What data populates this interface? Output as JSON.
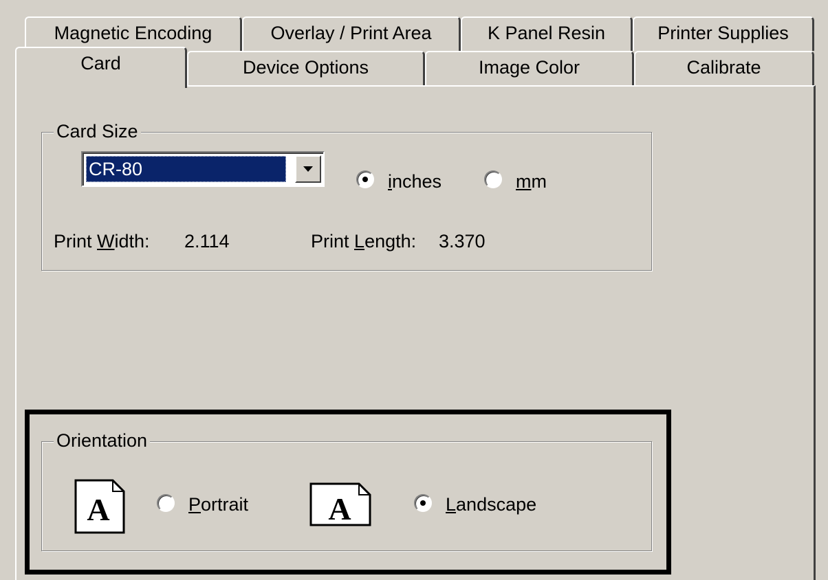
{
  "tabs_row1": [
    {
      "label": "Magnetic Encoding"
    },
    {
      "label": "Overlay / Print Area"
    },
    {
      "label": "K Panel Resin"
    },
    {
      "label": "Printer Supplies"
    }
  ],
  "tabs_row2": [
    {
      "label": "Card",
      "active": true
    },
    {
      "label": "Device Options"
    },
    {
      "label": "Image Color"
    },
    {
      "label": "Calibrate"
    }
  ],
  "card_size": {
    "group_label": "Card Size",
    "selected": "CR-80",
    "units": {
      "inches": {
        "prefix": "",
        "accel": "i",
        "rest": "nches",
        "checked": true
      },
      "mm": {
        "prefix": "",
        "accel": "m",
        "rest": "m",
        "checked": false
      }
    },
    "print_width": {
      "prefix": "Print ",
      "accel": "W",
      "rest": "idth:",
      "value": "2.114"
    },
    "print_length": {
      "prefix": "Print ",
      "accel": "L",
      "rest": "ength:",
      "value": "3.370"
    }
  },
  "orientation": {
    "group_label": "Orientation",
    "portrait": {
      "prefix": "",
      "accel": "P",
      "rest": "ortrait",
      "checked": false
    },
    "landscape": {
      "prefix": "",
      "accel": "L",
      "rest": "andscape",
      "checked": true
    },
    "icon_glyph": "A"
  },
  "colors": {
    "face": "#d4d0c8",
    "selection": "#0a246a",
    "highlight_frame": "#000000"
  }
}
